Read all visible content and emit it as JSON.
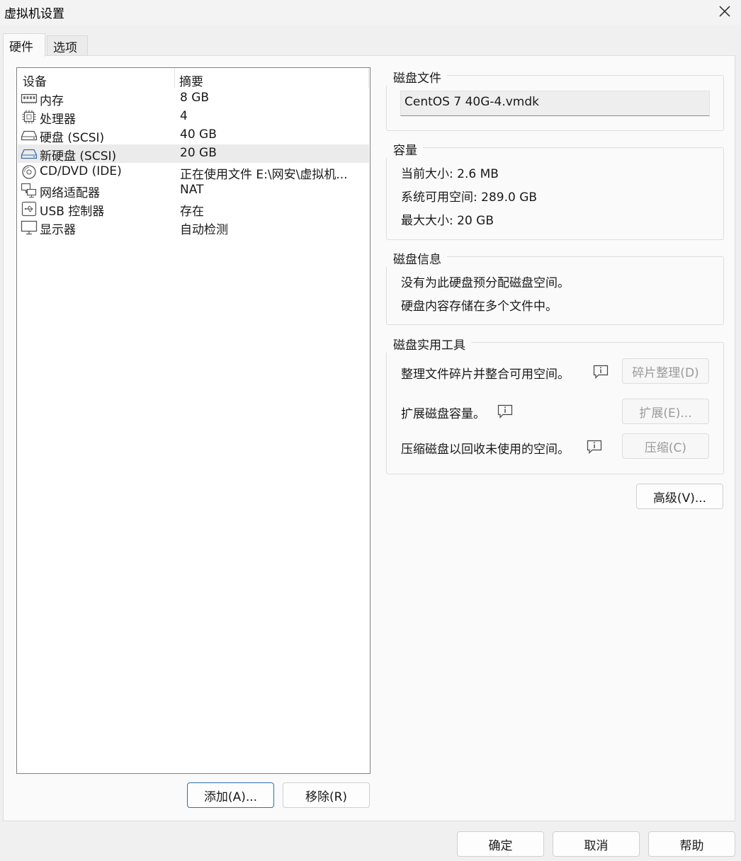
{
  "window": {
    "title": "虚拟机设置"
  },
  "tabs": [
    {
      "label": "硬件",
      "active": true
    },
    {
      "label": "选项",
      "active": false
    }
  ],
  "device_list": {
    "headers": {
      "device": "设备",
      "summary": "摘要"
    },
    "rows": [
      {
        "icon": "memory-icon",
        "name": "内存",
        "summary": "8 GB",
        "selected": false
      },
      {
        "icon": "processor-icon",
        "name": "处理器",
        "summary": "4",
        "selected": false
      },
      {
        "icon": "harddisk-icon",
        "name": "硬盘 (SCSI)",
        "summary": "40 GB",
        "selected": false
      },
      {
        "icon": "harddisk-icon",
        "name": "新硬盘 (SCSI)",
        "summary": "20 GB",
        "selected": true
      },
      {
        "icon": "cd-dvd-icon",
        "name": "CD/DVD (IDE)",
        "summary": "正在使用文件 E:\\网安\\虚拟机...",
        "selected": false
      },
      {
        "icon": "network-adapter-icon",
        "name": "网络适配器",
        "summary": "NAT",
        "selected": false
      },
      {
        "icon": "usb-icon",
        "name": "USB 控制器",
        "summary": "存在",
        "selected": false
      },
      {
        "icon": "display-icon",
        "name": "显示器",
        "summary": "自动检测",
        "selected": false
      }
    ]
  },
  "list_buttons": {
    "add": "添加(A)...",
    "remove": "移除(R)"
  },
  "disk_file": {
    "title": "磁盘文件",
    "value": "CentOS 7 40G-4.vmdk"
  },
  "capacity": {
    "title": "容量",
    "current_label": "当前大小:",
    "current_value": "2.6 MB",
    "available_label": "系统可用空间:",
    "available_value": "289.0 GB",
    "max_label": "最大大小:",
    "max_value": "20 GB"
  },
  "disk_info": {
    "title": "磁盘信息",
    "line1": "没有为此硬盘预分配磁盘空间。",
    "line2": "硬盘内容存储在多个文件中。"
  },
  "disk_utilities": {
    "title": "磁盘实用工具",
    "defrag_text": "整理文件碎片并整合可用空间。",
    "defrag_button": "碎片整理(D)",
    "expand_text": "扩展磁盘容量。",
    "expand_button": "扩展(E)...",
    "compact_text": "压缩磁盘以回收未使用的空间。",
    "compact_button": "压缩(C)"
  },
  "advanced_button": "高级(V)...",
  "footer": {
    "ok": "确定",
    "cancel": "取消",
    "help": "帮助"
  }
}
